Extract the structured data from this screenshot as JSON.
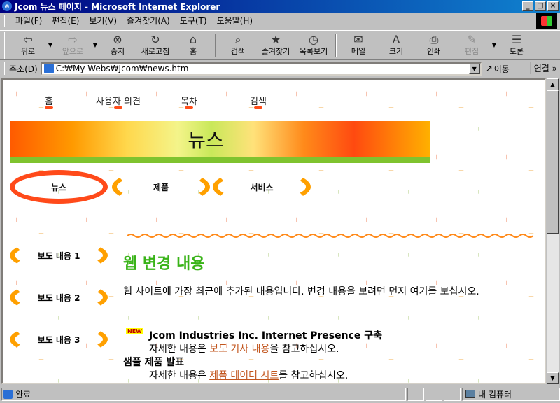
{
  "window": {
    "title": "Jcom 뉴스 페이지 - Microsoft Internet Explorer",
    "controls": {
      "minimize": "_",
      "maximize": "□",
      "close": "×"
    }
  },
  "menu": [
    "파일(F)",
    "편집(E)",
    "보기(V)",
    "즐겨찾기(A)",
    "도구(T)",
    "도움말(H)"
  ],
  "toolbar": {
    "back": "뒤로",
    "forward": "앞으로",
    "stop": "중지",
    "refresh": "새로고침",
    "home": "홈",
    "search": "검색",
    "favorites": "즐겨찾기",
    "history": "목록보기",
    "mail": "메일",
    "size": "크기",
    "print": "인쇄",
    "edit": "편집",
    "discuss": "토론"
  },
  "address": {
    "label": "주소(D)",
    "value": "C:₩My Webs₩Jcom₩news.htm",
    "go": "이동",
    "links": "연결 »"
  },
  "page": {
    "nav": [
      "홈",
      "사용자 의견",
      "목차",
      "검색"
    ],
    "banner_title": "뉴스",
    "tabs": [
      "뉴스",
      "제품",
      "서비스"
    ],
    "side": [
      "보도 내용 1",
      "보도 내용 2",
      "보도 내용 3"
    ],
    "heading": "웹 변경 내용",
    "intro": "웹 사이트에 가장 최근에 추가된 내용입니다. 변경 내용을 보려면 먼저 여기를 보십시오.",
    "new_badge": "NEW",
    "item1_title": "Jcom Industries Inc. Internet Presence 구축",
    "item1_pre": "자세한 내용은 ",
    "item1_link": "보도 기사 내용",
    "item1_post": "을 참고하십시오.",
    "item2_title": "샘플 제품 발표",
    "item2_pre": "자세한 내용은 ",
    "item2_link": "제품 데이터 시트",
    "item2_post": "를 참고하십시오."
  },
  "status": {
    "text": "완료",
    "zone": "내 컴퓨터"
  },
  "colors": {
    "title_bar": "#000080",
    "accent_red": "#ff4a1a",
    "accent_orange": "#ffa000",
    "heading_green": "#39b318",
    "link": "#c2561e"
  }
}
